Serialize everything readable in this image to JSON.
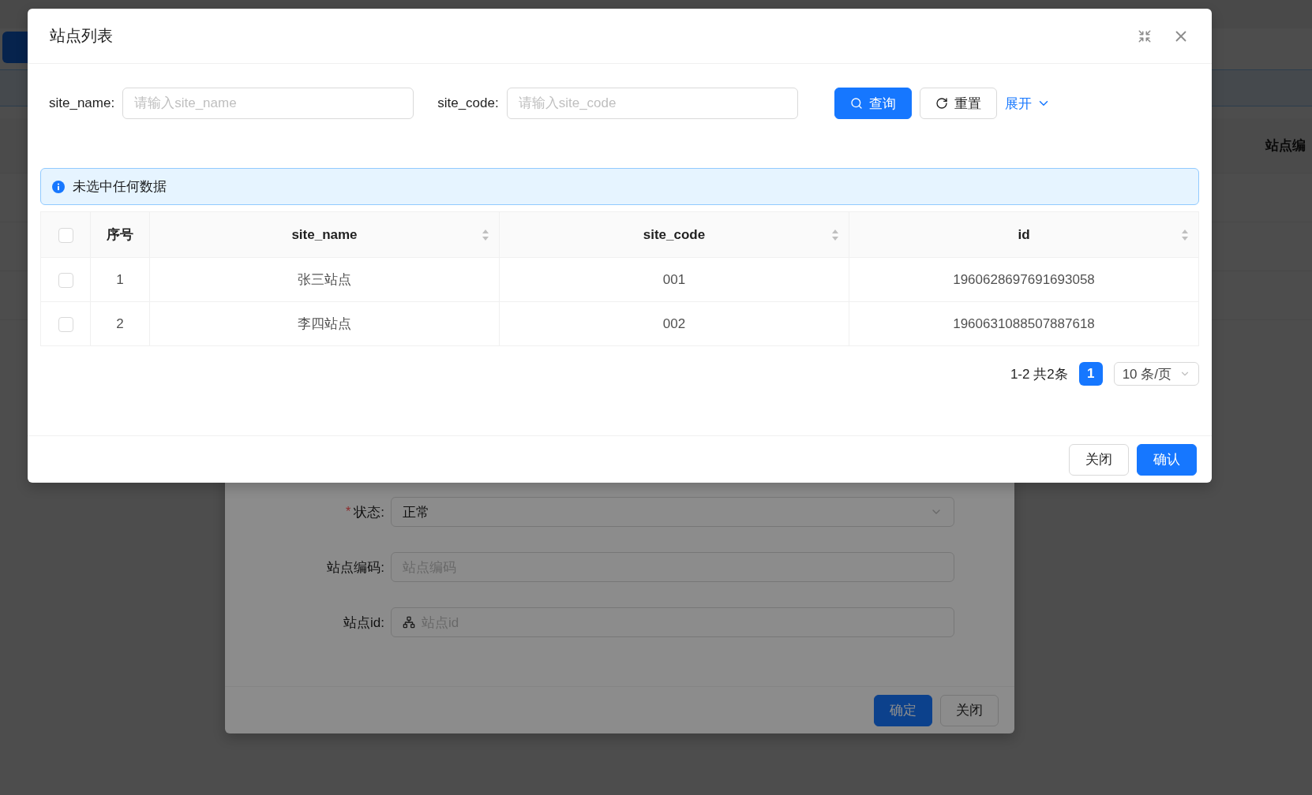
{
  "background_page": {
    "column_heading": "站点编"
  },
  "background_form": {
    "fields": [
      {
        "kind": "select",
        "required_mark": "*",
        "label": "状态:",
        "value": "正常"
      },
      {
        "kind": "input",
        "label": "站点编码:",
        "placeholder": "站点编码"
      },
      {
        "kind": "icon-input",
        "label": "站点id:",
        "placeholder": "站点id"
      }
    ],
    "buttons": [
      {
        "label": "确定",
        "primary": true
      },
      {
        "label": "关闭",
        "primary": false
      }
    ]
  },
  "dialog": {
    "title": "站点列表",
    "filters": [
      {
        "label": "site_name:",
        "placeholder": "请输入site_name"
      },
      {
        "label": "site_code:",
        "placeholder": "请输入site_code"
      }
    ],
    "search_button": "查询",
    "reset_button": "重置",
    "expand_link": "展开",
    "alert": "未选中任何数据",
    "table": {
      "all_checked": false,
      "columns": [
        {
          "label": "序号",
          "sortable": false
        },
        {
          "label": "site_name",
          "sortable": true
        },
        {
          "label": "site_code",
          "sortable": true
        },
        {
          "label": "id",
          "sortable": true
        }
      ],
      "rows": [
        {
          "checked": false,
          "cells": [
            "1",
            "张三站点",
            "001",
            "1960628697691693058"
          ]
        },
        {
          "checked": false,
          "cells": [
            "2",
            "李四站点",
            "002",
            "1960631088507887618"
          ]
        }
      ]
    },
    "pagination": {
      "summary": "1-2 共2条",
      "pages": [
        {
          "label": "1",
          "selected": true
        }
      ],
      "page_size": "10 条/页"
    },
    "footer_buttons": [
      {
        "label": "关闭",
        "primary": false
      },
      {
        "label": "确认",
        "primary": true
      }
    ]
  }
}
